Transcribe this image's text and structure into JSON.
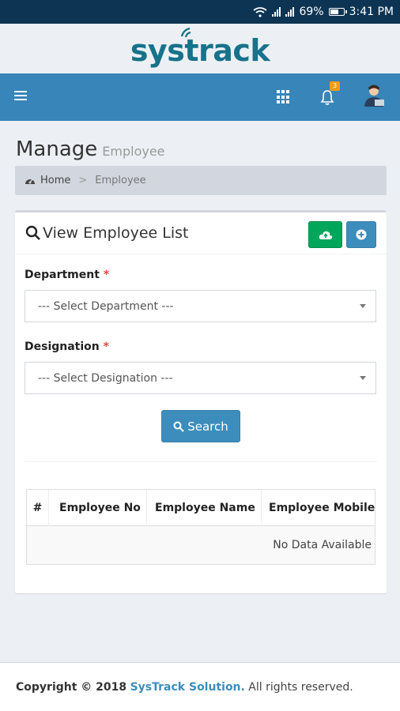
{
  "status_bar": {
    "battery": "69%",
    "battery_level": 0.69,
    "time": "3:41 PM"
  },
  "logo": {
    "text": "systrack"
  },
  "navbar": {
    "notification_count": "3"
  },
  "page": {
    "title": "Manage",
    "subtitle": "Employee"
  },
  "breadcrumb": {
    "home": "Home",
    "separator": ">",
    "current": "Employee"
  },
  "box": {
    "title": "View Employee List",
    "department_label": "Department",
    "department_placeholder": "--- Select Department ---",
    "designation_label": "Designation",
    "designation_placeholder": "--- Select Designation ---",
    "required_mark": "*",
    "search_label": "Search"
  },
  "table": {
    "columns": [
      "#",
      "Employee No",
      "Employee Name",
      "Employee Mobile"
    ],
    "empty_message": "No Data Available"
  },
  "footer": {
    "copyright": "Copyright © 2018",
    "company": "SysTrack Solution.",
    "rights": "All rights reserved."
  },
  "colors": {
    "navbar": "#3785b9",
    "status_bar": "#0d3452",
    "upload_button": "#00a65a",
    "primary_button": "#3c8dbc",
    "logo": "#17728a",
    "badge": "#f39c12"
  },
  "icons": {
    "menu": "hamburger-icon",
    "apps": "grid-icon",
    "notifications": "bell-icon",
    "user": "avatar",
    "upload": "cloud-upload-icon",
    "add": "plus-circle-icon",
    "search": "search-icon",
    "home": "dashboard-icon"
  }
}
